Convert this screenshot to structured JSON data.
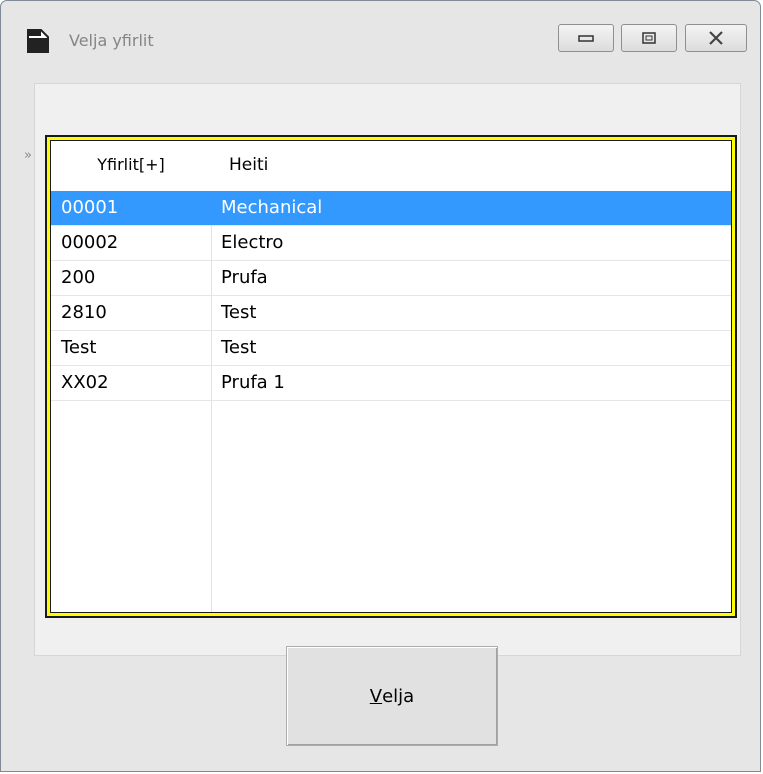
{
  "window": {
    "title": "Velja yfirlit",
    "icon": "document-icon",
    "controls": [
      "minimize-icon",
      "maximize-icon",
      "close-icon"
    ]
  },
  "expand_glyph": "»",
  "grid": {
    "columns": [
      "Yfirlit[+]",
      "Heiti"
    ],
    "rows": [
      {
        "code": "00001",
        "name": "Mechanical",
        "selected": true
      },
      {
        "code": "00002",
        "name": "Electro",
        "selected": false
      },
      {
        "code": "200",
        "name": "Prufa",
        "selected": false
      },
      {
        "code": "2810",
        "name": "Test",
        "selected": false
      },
      {
        "code": "Test",
        "name": "Test",
        "selected": false
      },
      {
        "code": "XX02",
        "name": "Prufa 1",
        "selected": false
      }
    ]
  },
  "button": {
    "mnemonic": "V",
    "rest": "elja"
  },
  "colors": {
    "selection": "#3399ff",
    "grid_border": "#fffe00",
    "window_bg": "#e6e6e6"
  }
}
